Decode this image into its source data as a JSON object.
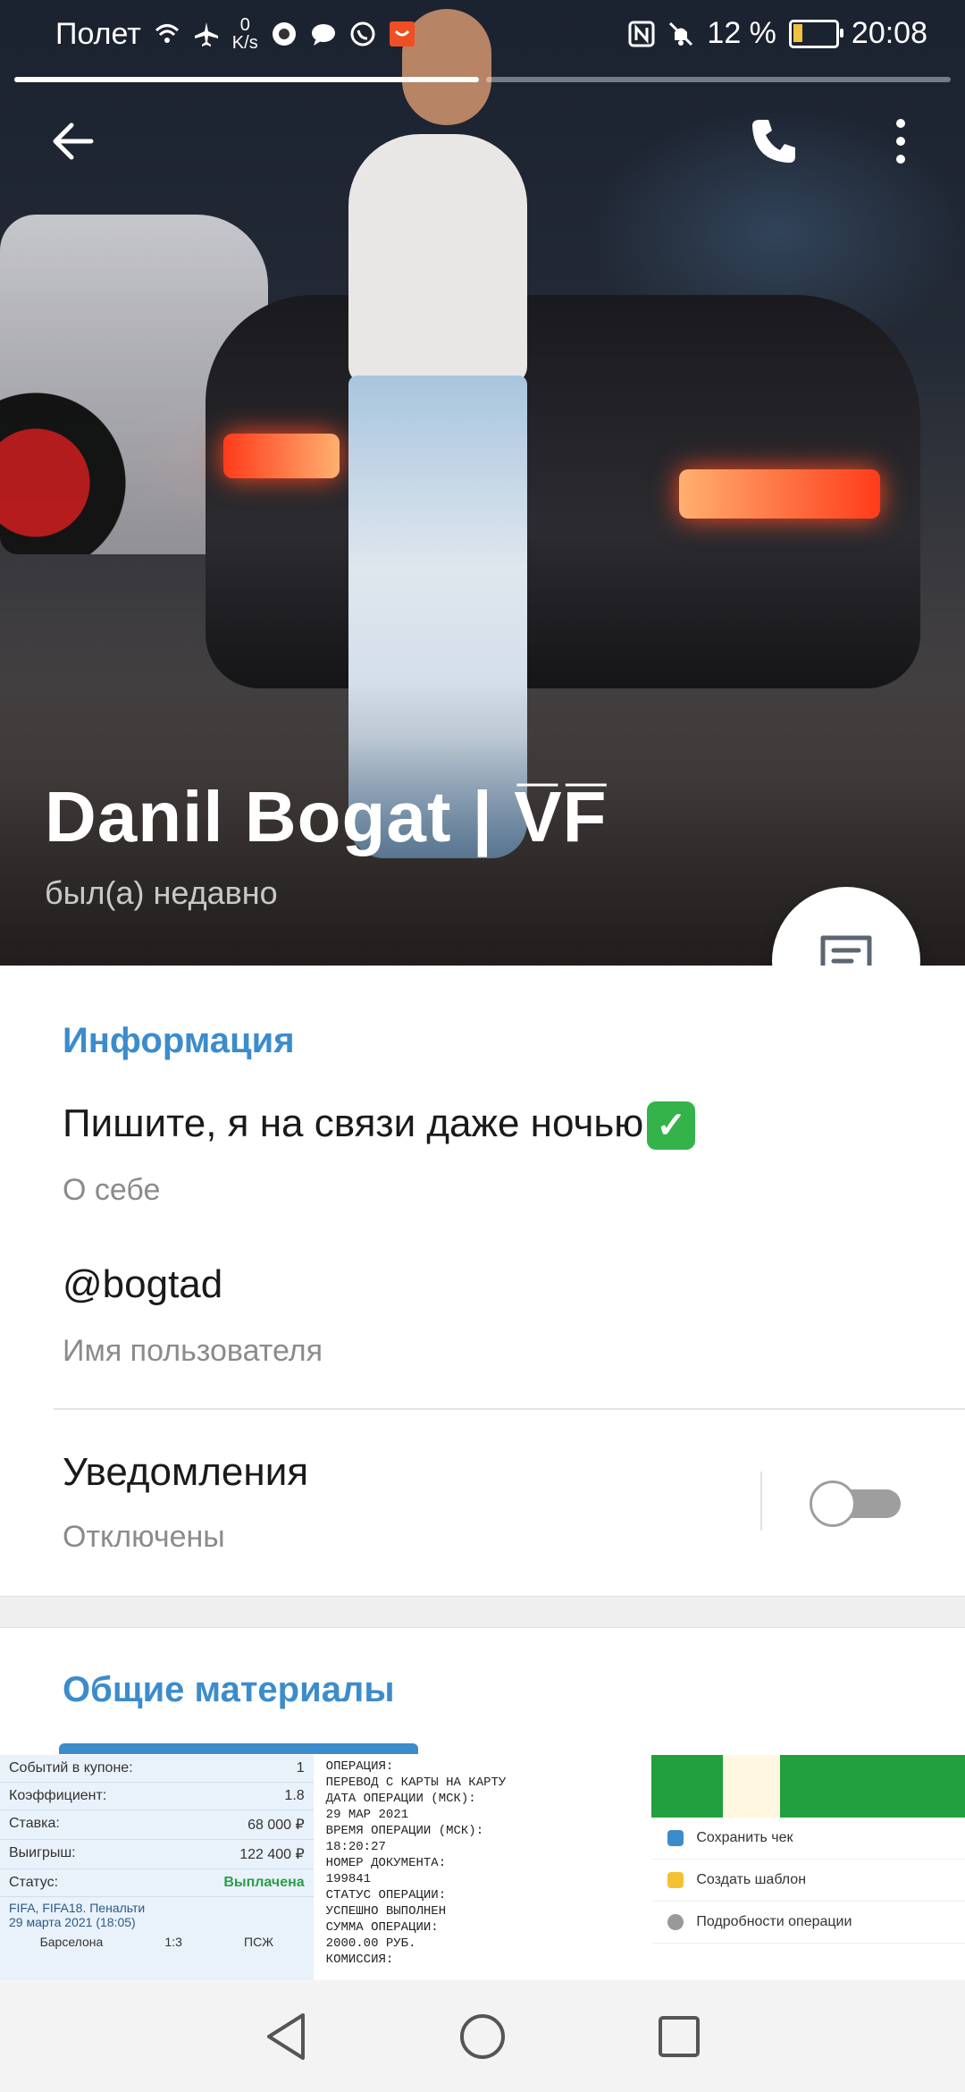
{
  "status_bar": {
    "carrier": "Полет",
    "net_speed_value": "0",
    "net_speed_unit": "K/s",
    "battery_percent": "12 %",
    "time": "20:08"
  },
  "header": {
    "name": "Danil Bogat | V̅F̅",
    "last_seen": "был(а) недавно",
    "story_segments": 2,
    "active_segment": 0
  },
  "info": {
    "section_title": "Информация",
    "bio": "Пишите, я на связи даже ночью",
    "bio_label": "О себе",
    "username": "@bogtad",
    "username_label": "Имя пользователя",
    "notifications": "Уведомления",
    "notifications_state": "Отключены",
    "notifications_enabled": false
  },
  "media": {
    "section_title": "Общие материалы",
    "tile1": {
      "rows": [
        {
          "k": "Событий в купоне:",
          "v": "1"
        },
        {
          "k": "Коэффициент:",
          "v": "1.8"
        },
        {
          "k": "Ставка:",
          "v": "68 000 ₽"
        },
        {
          "k": "Выигрыш:",
          "v": "122 400 ₽"
        },
        {
          "k": "Статус:",
          "v": "Выплачена"
        }
      ],
      "match_line1": "FIFA, FIFA18. Пенальти",
      "match_line2": "29 марта 2021 (18:05)",
      "team1": "Барселона",
      "score": "1:3",
      "team2": "ПСЖ"
    },
    "tile2": {
      "lines": [
        "ОПЕРАЦИЯ:",
        "ПЕРЕВОД С КАРТЫ НА КАРТУ",
        "ДАТА ОПЕРАЦИИ (МСК):",
        "29 МАР 2021",
        "ВРЕМЯ ОПЕРАЦИИ (МСК):",
        "18:20:27",
        "НОМЕР ДОКУМЕНТА:",
        "199841",
        "СТАТУС ОПЕРАЦИИ:",
        "УСПЕШНО ВЫПОЛНЕН",
        "СУММА ОПЕРАЦИИ:",
        "2000.00 РУБ.",
        "КОМИССИЯ:"
      ]
    },
    "tile3": {
      "items": [
        "Сохранить чек",
        "Создать шаблон",
        "Подробности операции"
      ]
    }
  },
  "colors": {
    "accent": "#3c8ccc",
    "check": "#33b34a",
    "nav_bg": "#f3f3f3"
  },
  "icons": {
    "back": "arrow-left-icon",
    "call": "phone-icon",
    "menu": "more-vertical-icon",
    "fab": "message-icon"
  }
}
